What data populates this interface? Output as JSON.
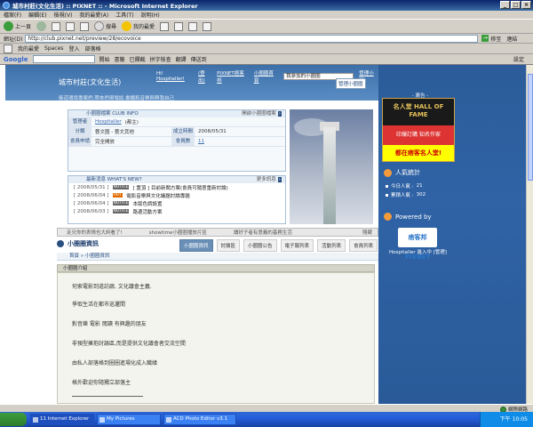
{
  "window": {
    "title": "城市村莊(文化生活) :: PIXNET :: - Microsoft Internet Explorer",
    "controls": [
      "_",
      "□",
      "×"
    ]
  },
  "menu": [
    "檔案(F)",
    "編輯(E)",
    "檢視(V)",
    "我的最愛(A)",
    "工具(T)",
    "說明(H)"
  ],
  "toolbar": {
    "back": "上一頁",
    "search": "搜尋",
    "favorites": "我的最愛"
  },
  "address": {
    "label": "網址(D)",
    "url": "http://club.pixnet.net/preview/28/ecovoice",
    "go": "移至",
    "links": "連結"
  },
  "linksbar": {
    "items": [
      "我的最愛",
      "Spaces",
      "登入",
      "部落格"
    ]
  },
  "googlebar": {
    "logo": "Google",
    "search_btn": "搜尋",
    "items": [
      "開始",
      "書籤",
      "已攔截",
      "拼字檢查",
      "翻譯",
      "傳送到",
      "設定"
    ]
  },
  "blog": {
    "title": "城市村莊(文化生活)",
    "subtitle": "衛道環境專案們,帶來們現場談,書櫃和音樂與興我自己",
    "greeting": "Hi!",
    "user": "Hospitaller!",
    "logout": "(登出)",
    "nav": [
      "PIXNET痞客邦",
      "小圈圈首頁"
    ],
    "my_circles": "我參加的小圈圈",
    "manage_circle": "管理小圈",
    "manage_btn": "管理小圈圈"
  },
  "club_info": {
    "head": "小圈圈檔案 CLUB INFO",
    "more": "開啟小圈圈檔案",
    "rows": [
      {
        "label": "管理者",
        "value": "Hospitaller",
        "extra": "(都主)"
      },
      {
        "label": "分類",
        "value": "藝文圈 - 藝文其他",
        "label2": "成立時間",
        "value2": "2008/05/31"
      },
      {
        "label": "會員申請",
        "value": "完全開放",
        "label2": "會員數",
        "value2": "11"
      }
    ]
  },
  "news": {
    "head": "最新消息 WHAT'S NEW?",
    "more": "更多訊息",
    "items": [
      {
        "date": "[ 2008/05/31 ]",
        "tag": "NOTICE",
        "tag_type": "notice",
        "text": "[ 置頂 ] 目前新聞方案(會員可隨意重新討論)"
      },
      {
        "date": "[ 2008/06/04 ]",
        "tag": "HOT",
        "tag_type": "hot",
        "text": "電影音樂與文化議題討論專題"
      },
      {
        "date": "[ 2008/06/04 ]",
        "tag": "NOTICE",
        "tag_type": "notice",
        "text": "本版色調設置"
      },
      {
        "date": "[ 2008/06/03 ]",
        "tag": "NOTICE",
        "tag_type": "notice",
        "text": "路邊活動方案"
      }
    ]
  },
  "marquee": [
    "走兄你的表情也大詞看了!",
    "showtime小圈圈播放片區",
    "讀好子者有意義的基務生活",
    "隱藏"
  ],
  "circle": {
    "title": "小圈圈資訊",
    "tabs": [
      "小圈圈資訊",
      "討論區",
      "小圈圈公告",
      "電子報列表",
      "活動列表",
      "會員列表"
    ],
    "active_tab": 0,
    "breadcrumb_home": "首頁",
    "breadcrumb_sep": "»",
    "breadcrumb_current": "小圈圈資訊"
  },
  "intro": {
    "head": "小圈圈介紹",
    "lines": [
      "何索電影到道訪廊, 文化議會主義.",
      "爭取生活在都市巡邏間",
      "對音樂  電影  閱讀  有興趣的朋友",
      "非預型擁抱討論區,而是提供文化議會者交流空間",
      "由私人部落格到圈圈進場化成入職緣",
      "格外歡迎你隨獨立部落主"
    ]
  },
  "sidebar": {
    "ad_label": "- 廣告 -",
    "ad_top": "名人堂 HALL OF FAME",
    "ad_mid": "印爆訂購  知名作家",
    "ad_bot": "都在痞客名人堂!",
    "stats_head": "人氣統計",
    "today_label": "今日人氣 :",
    "today_value": "21",
    "total_label": "累積人氣 :",
    "total_value": "302",
    "powered": "Powered by",
    "pix_logo": "痞客邦 PIXNET",
    "pix_caption": "Hospitaller 進入中 [管理]"
  },
  "status": {
    "zone": "網際網路"
  },
  "taskbar": {
    "tasks": [
      "11 Internet Explorer",
      "My Pictures",
      "ACD Photo Editor v3.1"
    ],
    "clock": "下午 10:05"
  }
}
